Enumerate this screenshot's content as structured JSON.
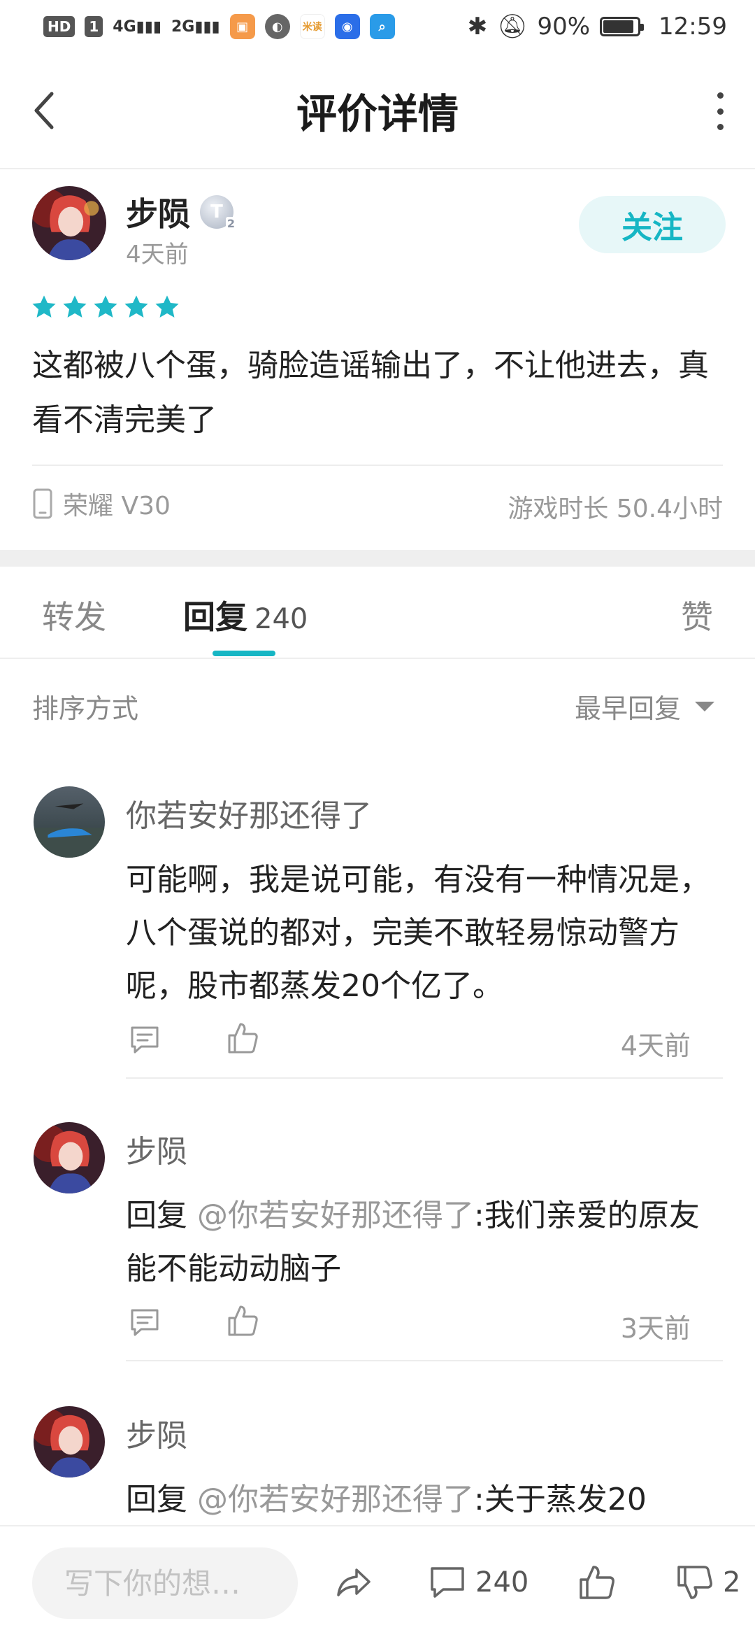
{
  "status_bar": {
    "hd_label": "HD",
    "sim_label": "1",
    "signal1_label": "4G",
    "signal2_label": "2G",
    "app_icon_label": "米读",
    "battery_percent": "90%",
    "time": "12:59",
    "battery_level": 0.9
  },
  "nav": {
    "title": "评价详情"
  },
  "review": {
    "author": "步陨",
    "level_badge": "T",
    "level_sub": "2",
    "time": "4天前",
    "follow_label": "关注",
    "rating": 5,
    "content": "这都被八个蛋，骑脸造谣输出了，不让他进去，真看不清完美了",
    "device": "荣耀 V30",
    "playtime": "游戏时长 50.4小时"
  },
  "tabs": {
    "forward": "转发",
    "reply": "回复",
    "reply_count": "240",
    "like": "赞"
  },
  "sort": {
    "label": "排序方式",
    "value": "最早回复"
  },
  "replies": [
    {
      "author": "你若安好那还得了",
      "text": "可能啊，我是说可能，有没有一种情况是，八个蛋说的都对，完美不敢轻易惊动警方呢，股市都蒸发20个亿了。",
      "time": "4天前"
    },
    {
      "author": "步陨",
      "prefix": " 回复 ",
      "mention": "@你若安好那还得了",
      "text": ":我们亲爱的原友能不能动动脑子",
      "time": "3天前"
    },
    {
      "author": "步陨",
      "prefix": " 回复 ",
      "mention": "@你若安好那还得了",
      "text": ":关于蒸发20"
    }
  ],
  "bottom_bar": {
    "input_placeholder": "写下你的想…",
    "comment_count": "240",
    "dislike_count": "2"
  },
  "colors": {
    "accent": "#16b6c4",
    "follow_bg": "#e7f7f8",
    "star": "#1fb8c7",
    "muted_text": "#999999"
  }
}
